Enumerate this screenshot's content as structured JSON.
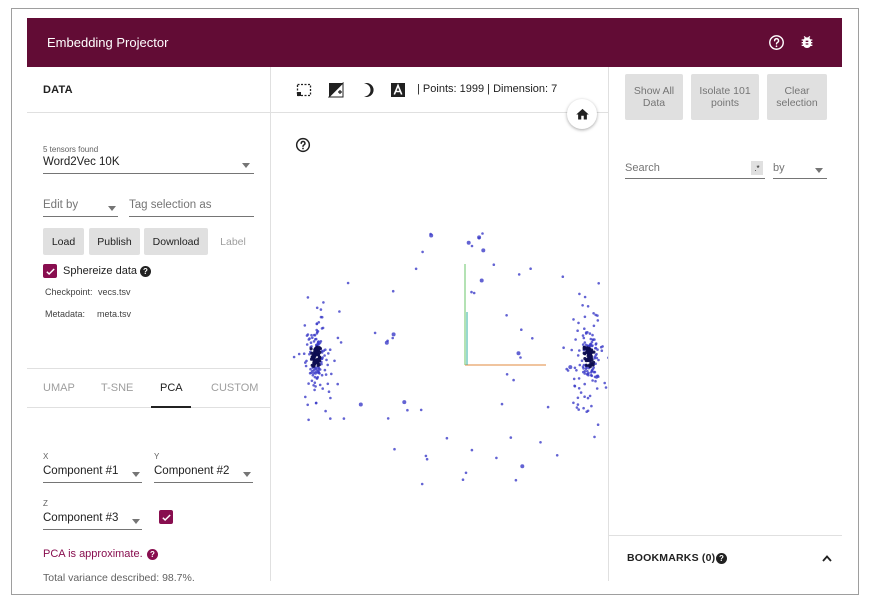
{
  "app": {
    "title": "Embedding Projector",
    "accent_color": "#620c35",
    "checkbox_color": "#880e4f"
  },
  "header_icons": [
    "help-circle-icon",
    "bug-icon"
  ],
  "data_panel": {
    "header": "DATA",
    "tensors_found": "5 tensors found",
    "tensor_selected": "Word2Vec 10K",
    "edit_by": "Edit by",
    "tag_placeholder": "Tag selection as",
    "buttons": {
      "load": "Load",
      "publish": "Publish",
      "download": "Download",
      "label": "Label"
    },
    "sphereize_label": "Sphereize data",
    "sphereize_checked": true,
    "checkpoint_label": "Checkpoint:",
    "checkpoint_value": "vecs.tsv",
    "metadata_label": "Metadata:",
    "metadata_value": "meta.tsv"
  },
  "projection_tabs": [
    {
      "label": "UMAP",
      "active": false
    },
    {
      "label": "T-SNE",
      "active": false
    },
    {
      "label": "PCA",
      "active": true
    },
    {
      "label": "CUSTOM",
      "active": false
    }
  ],
  "pca": {
    "x_label": "X",
    "x_value": "Component #1",
    "y_label": "Y",
    "y_value": "Component #2",
    "z_label": "Z",
    "z_value": "Component #3",
    "z_enabled": true,
    "approx_text": "PCA is approximate.",
    "variance_text": "Total variance described: 98.7%."
  },
  "toolbar": {
    "tools": [
      "select-rectangle-icon",
      "night-mode-icon",
      "moon-icon",
      "labels-icon"
    ],
    "points_label": "Points: 1999",
    "dimension_label": "Dimension: 7"
  },
  "inspector": {
    "show_all": "Show All Data",
    "isolate": "Isolate 101 points",
    "clear": "Clear selection",
    "search_placeholder": "Search",
    "regex_toggle": ".*",
    "by_label": "by",
    "bookmarks_label": "BOOKMARKS (0)"
  },
  "chart_data": {
    "type": "scatter",
    "point_color": "#3c3cc8",
    "dense_color": "#0d0d50",
    "axis_colors": {
      "x": "#e08a3c",
      "y": "#69c46a",
      "z": "#2a5bd7"
    },
    "clusters": [
      {
        "name": "left",
        "count": 180
      },
      {
        "name": "right",
        "count": 180
      }
    ]
  }
}
